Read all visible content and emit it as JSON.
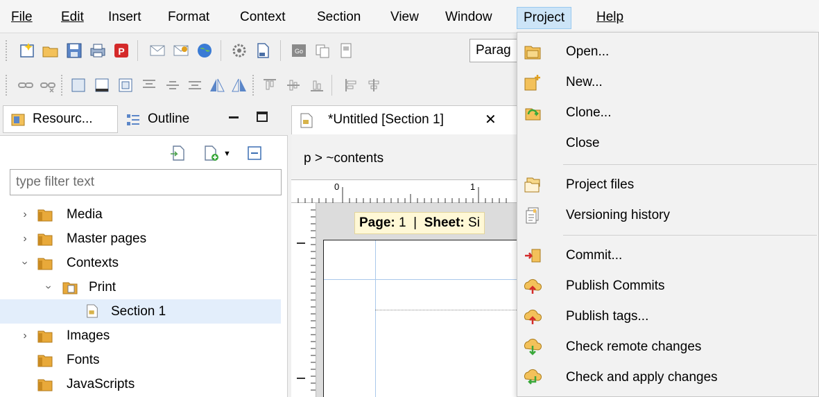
{
  "menubar": {
    "items": [
      "File",
      "Edit",
      "Insert",
      "Format",
      "Context",
      "Section",
      "View",
      "Window",
      "Project",
      "Help"
    ],
    "active": "Project"
  },
  "toolbar": {
    "style_combo_value": "Parag"
  },
  "left_panel": {
    "tabs": [
      "Resourc...",
      "Outline"
    ],
    "filter_placeholder": "type filter text",
    "tree": [
      {
        "label": "Media",
        "depth": 0,
        "chevron": "right"
      },
      {
        "label": "Master pages",
        "depth": 0,
        "chevron": "right"
      },
      {
        "label": "Contexts",
        "depth": 0,
        "chevron": "down"
      },
      {
        "label": "Print",
        "depth": 1,
        "chevron": "down"
      },
      {
        "label": "Section 1",
        "depth": 2,
        "chevron": "",
        "selected": true
      },
      {
        "label": "Images",
        "depth": 0,
        "chevron": "right"
      },
      {
        "label": "Fonts",
        "depth": 0,
        "chevron": ""
      },
      {
        "label": "JavaScripts",
        "depth": 0,
        "chevron": ""
      }
    ]
  },
  "editor": {
    "tab_title": "*Untitled [Section 1]",
    "breadcrumb": "p > ~contents",
    "ruler_labels": [
      "0",
      "1"
    ],
    "pager_page_label": "Page:",
    "pager_page_value": "1",
    "pager_sheet_label": "Sheet:",
    "pager_sheet_value": "Si"
  },
  "project_menu": {
    "items": [
      {
        "label": "Open...",
        "icon": "folder-open-icon"
      },
      {
        "label": "New...",
        "icon": "new-project-icon"
      },
      {
        "label": "Clone...",
        "icon": "clone-icon"
      },
      {
        "label": "Close",
        "icon": ""
      },
      {
        "label": "Project files",
        "icon": "project-files-icon"
      },
      {
        "label": "Versioning history",
        "icon": "history-icon"
      },
      {
        "label": "Commit...",
        "icon": "commit-icon"
      },
      {
        "label": "Publish Commits",
        "icon": "publish-commits-icon"
      },
      {
        "label": "Publish tags...",
        "icon": "publish-tags-icon"
      },
      {
        "label": "Check remote changes",
        "icon": "check-remote-icon"
      },
      {
        "label": "Check and apply changes",
        "icon": "apply-changes-icon"
      }
    ]
  },
  "colors": {
    "menu_active_bg": "#cce4f7",
    "selection_bg": "#e3eefb",
    "folder": "#e8a93a"
  }
}
